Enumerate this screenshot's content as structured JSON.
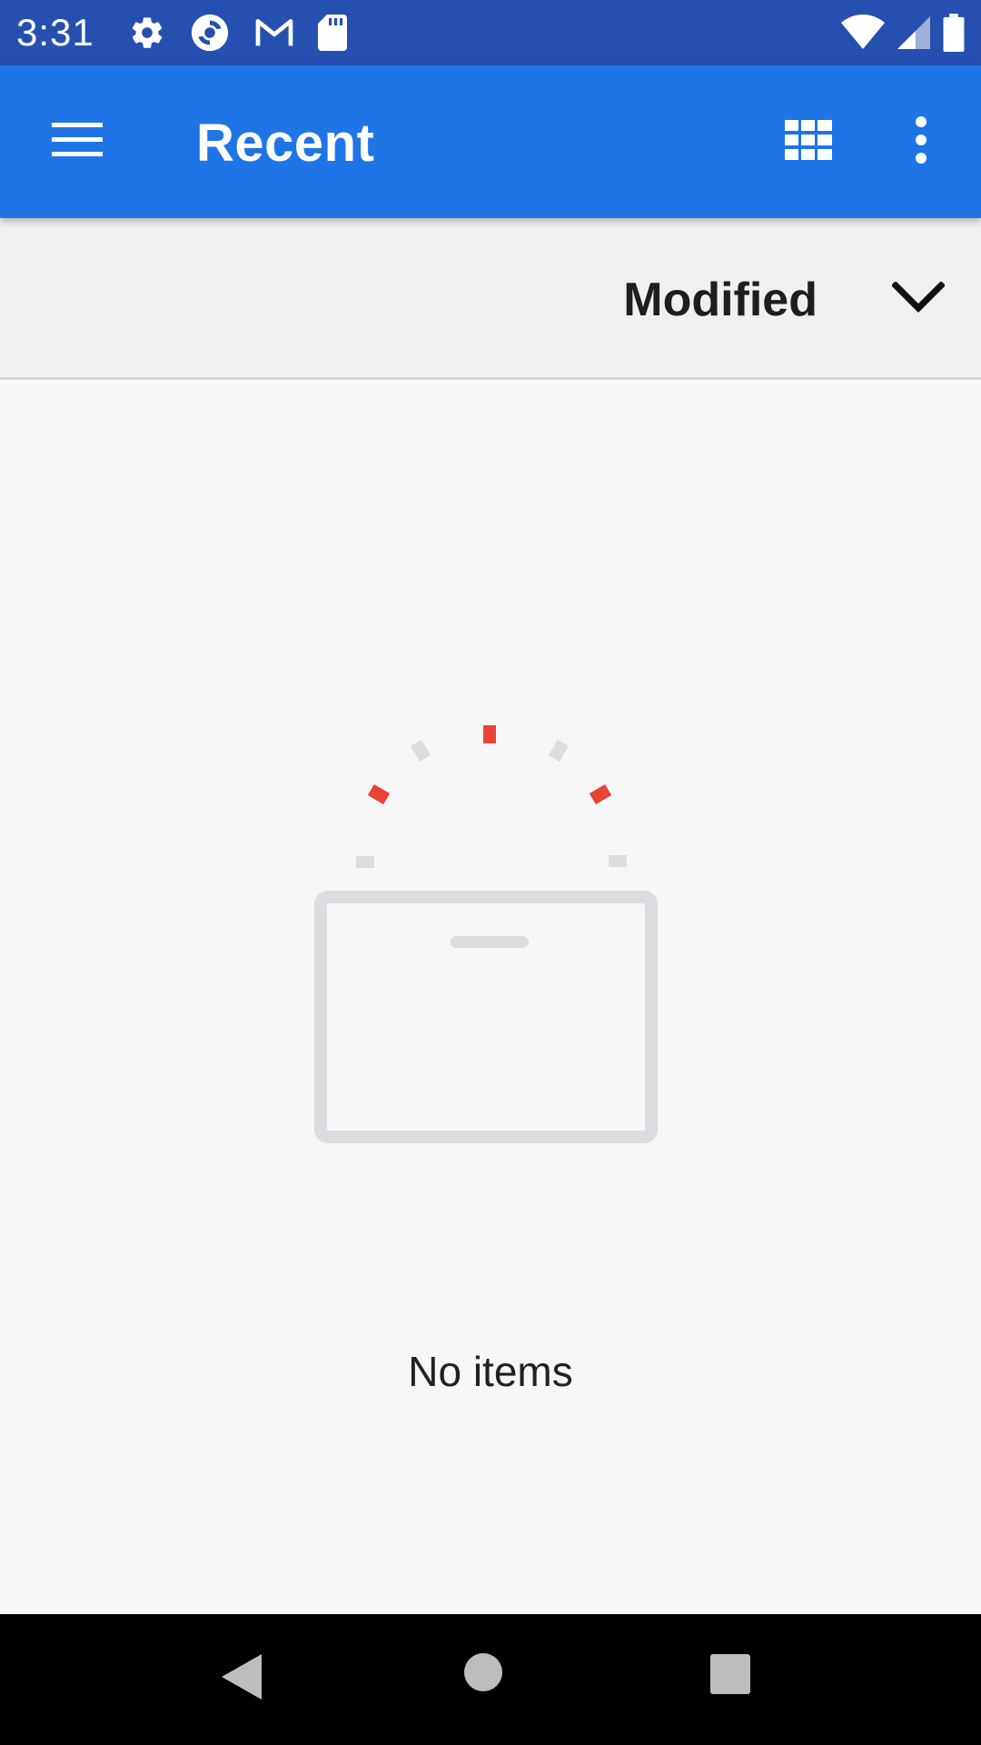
{
  "status_bar": {
    "time": "3:31",
    "left_icons": [
      "settings-icon",
      "sync-icon",
      "gmail-icon",
      "sd-card-icon"
    ],
    "right_icons": [
      "wifi-icon",
      "cell-signal-icon",
      "battery-icon"
    ]
  },
  "app_bar": {
    "title": "Recent",
    "background": "#1f75e6",
    "menu_icon": "hamburger-menu-icon",
    "view_toggle_icon": "grid-view-icon",
    "overflow_icon": "more-vert-icon"
  },
  "sort_bar": {
    "label": "Modified",
    "icon": "chevron-down-icon"
  },
  "empty_state": {
    "message": "No items",
    "illustration": "empty-folder-icon",
    "accent_color": "#ea4335",
    "muted_color": "#dadce0"
  },
  "nav_bar": {
    "buttons": [
      "back-icon",
      "home-icon",
      "recents-icon"
    ]
  }
}
